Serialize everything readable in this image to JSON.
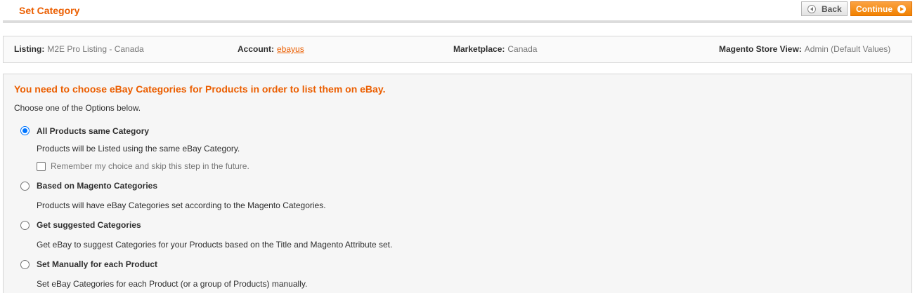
{
  "header": {
    "title": "Set Category",
    "back_label": "Back",
    "continue_label": "Continue"
  },
  "info": {
    "listing_label": "Listing:",
    "listing_value": "M2E Pro Listing - Canada",
    "account_label": "Account:",
    "account_value": "ebayus",
    "marketplace_label": "Marketplace:",
    "marketplace_value": "Canada",
    "store_view_label": "Magento Store View:",
    "store_view_value": "Admin (Default Values)"
  },
  "content": {
    "notice": "You need to choose eBay Categories for Products in order to list them on eBay.",
    "intro": "Choose one of the Options below.",
    "options": [
      {
        "label": "All Products same Category",
        "description": "Products will be Listed using the same eBay Category.",
        "selected": true
      },
      {
        "label": "Based on Magento Categories",
        "description": "Products will have eBay Categories set according to the Magento Categories.",
        "selected": false
      },
      {
        "label": "Get suggested Categories",
        "description": "Get eBay to suggest Categories for your Products based on the Title and Magento Attribute set.",
        "selected": false
      },
      {
        "label": "Set Manually for each Product",
        "description": "Set eBay Categories for each Product (or a group of Products) manually.",
        "selected": false
      }
    ],
    "remember_label": "Remember my choice and skip this step in the future.",
    "remember_checked": false
  },
  "colors": {
    "accent": "#eb5e00",
    "button_orange": "#f18200",
    "radio_selected": "#0075ff"
  }
}
